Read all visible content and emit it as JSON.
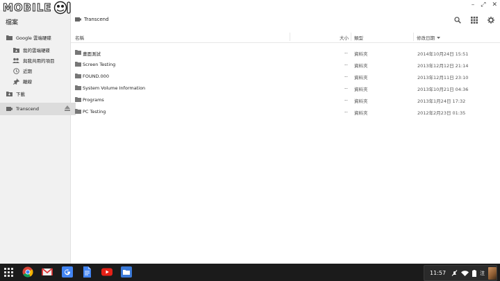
{
  "watermark": {
    "text": "MOBILE"
  },
  "window": {
    "controls": [
      "–",
      "⤢",
      "✕"
    ]
  },
  "sidebar": {
    "title": "檔案",
    "items": [
      {
        "label": "Google 雲端硬碟",
        "icon": "drive-icon"
      },
      {
        "label": "我的雲端硬碟",
        "icon": "my-drive-icon"
      },
      {
        "label": "與我共用的項目",
        "icon": "shared-icon"
      },
      {
        "label": "近期",
        "icon": "clock-icon"
      },
      {
        "label": "離線",
        "icon": "pin-icon"
      },
      {
        "label": "下載",
        "icon": "download-icon"
      },
      {
        "label": "Transcend",
        "icon": "usb-drive-icon"
      }
    ]
  },
  "toolbar": {
    "breadcrumb": "Transcend"
  },
  "columns": {
    "name": "名稱",
    "size": "大小",
    "type": "類型",
    "date": "修改日期"
  },
  "files": [
    {
      "name": "畫面測試",
      "size": "--",
      "type": "資料夾",
      "date": "2014年10月24日 15:51"
    },
    {
      "name": "Screen Testing",
      "size": "--",
      "type": "資料夾",
      "date": "2013年12月12日 21:14"
    },
    {
      "name": "FOUND.000",
      "size": "--",
      "type": "資料夾",
      "date": "2013年12月11日 23:10"
    },
    {
      "name": "System Volume Information",
      "size": "--",
      "type": "資料夾",
      "date": "2013年10月21日 04:36"
    },
    {
      "name": "Programs",
      "size": "--",
      "type": "資料夾",
      "date": "2013年1月24日 17:32"
    },
    {
      "name": "PC Testing",
      "size": "--",
      "type": "資料夾",
      "date": "2012年2月23日 01:35"
    }
  ],
  "shelf": {
    "clock": "11:57",
    "ime": "注"
  }
}
